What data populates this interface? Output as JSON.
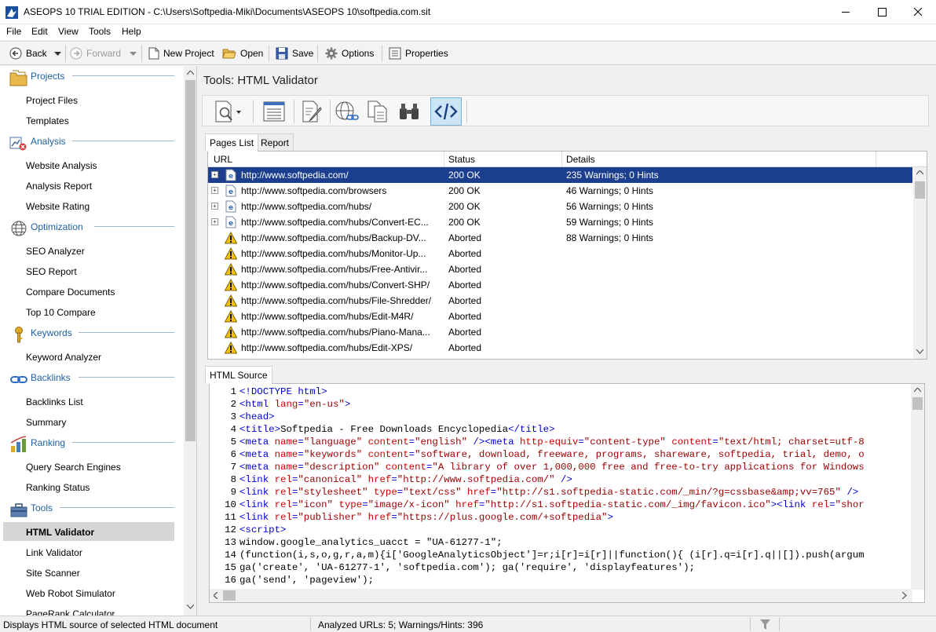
{
  "window": {
    "title": "ASEOPS 10 TRIAL EDITION - C:\\Users\\Softpedia-Miki\\Documents\\ASEOPS 10\\softpedia.com.sit",
    "minimize_icon": "minimize-icon",
    "maximize_icon": "maximize-icon",
    "close_icon": "close-icon"
  },
  "menu": [
    "File",
    "Edit",
    "View",
    "Tools",
    "Help"
  ],
  "toolbar": {
    "back": "Back",
    "forward": "Forward",
    "new_project": "New Project",
    "open": "Open",
    "save": "Save",
    "options": "Options",
    "properties": "Properties"
  },
  "sidebar": {
    "categories": [
      {
        "label": "Projects",
        "icon": "folders-icon",
        "items": [
          "Project Files",
          "Templates"
        ]
      },
      {
        "label": "Analysis",
        "icon": "analysis-icon",
        "items": [
          "Website Analysis",
          "Analysis Report",
          "Website Rating"
        ]
      },
      {
        "label": "Optimization",
        "icon": "globe-icon",
        "items": [
          "SEO Analyzer",
          "SEO Report",
          "Compare Documents",
          "Top 10 Compare"
        ]
      },
      {
        "label": "Keywords",
        "icon": "key-icon",
        "items": [
          "Keyword Analyzer"
        ]
      },
      {
        "label": "Backlinks",
        "icon": "chain-link-icon",
        "items": [
          "Backlinks List",
          "Summary"
        ]
      },
      {
        "label": "Ranking",
        "icon": "ranking-chart-icon",
        "items": [
          "Query Search Engines",
          "Ranking Status"
        ]
      },
      {
        "label": "Tools",
        "icon": "toolbox-icon",
        "items": [
          "HTML Validator",
          "Link Validator",
          "Site Scanner",
          "Web Robot Simulator",
          "PageRank Calculator"
        ]
      }
    ],
    "selected": "HTML Validator"
  },
  "main": {
    "title": "Tools: HTML Validator",
    "tools": [
      "validate-page-icon",
      "list-icon",
      "edit-page-icon",
      "globe-link-icon",
      "copy-pages-icon",
      "binoculars-icon",
      "code-view-icon"
    ]
  },
  "pages_panel": {
    "tabs": [
      "Pages List",
      "Report"
    ],
    "active_tab": "Pages List",
    "columns": [
      "URL",
      "Status",
      "Details"
    ],
    "rows": [
      {
        "url": "http://www.softpedia.com/",
        "status": "200 OK",
        "details": "235 Warnings; 0 Hints",
        "type": "page",
        "selected": true
      },
      {
        "url": "http://www.softpedia.com/browsers",
        "status": "200 OK",
        "details": "46 Warnings; 0 Hints",
        "type": "page"
      },
      {
        "url": "http://www.softpedia.com/hubs/",
        "status": "200 OK",
        "details": "56 Warnings; 0 Hints",
        "type": "page"
      },
      {
        "url": "http://www.softpedia.com/hubs/Convert-EC...",
        "status": "200 OK",
        "details": "59 Warnings; 0 Hints",
        "type": "page"
      },
      {
        "url": "http://www.softpedia.com/hubs/Backup-DV...",
        "status": "Aborted",
        "details": "88 Warnings; 0 Hints",
        "type": "warning"
      },
      {
        "url": "http://www.softpedia.com/hubs/Monitor-Up...",
        "status": "Aborted",
        "details": "",
        "type": "warning"
      },
      {
        "url": "http://www.softpedia.com/hubs/Free-Antivir...",
        "status": "Aborted",
        "details": "",
        "type": "warning"
      },
      {
        "url": "http://www.softpedia.com/hubs/Convert-SHP/",
        "status": "Aborted",
        "details": "",
        "type": "warning"
      },
      {
        "url": "http://www.softpedia.com/hubs/File-Shredder/",
        "status": "Aborted",
        "details": "",
        "type": "warning"
      },
      {
        "url": "http://www.softpedia.com/hubs/Edit-M4R/",
        "status": "Aborted",
        "details": "",
        "type": "warning"
      },
      {
        "url": "http://www.softpedia.com/hubs/Piano-Mana...",
        "status": "Aborted",
        "details": "",
        "type": "warning"
      },
      {
        "url": "http://www.softpedia.com/hubs/Edit-XPS/",
        "status": "Aborted",
        "details": "",
        "type": "warning"
      }
    ]
  },
  "source_panel": {
    "tab": "HTML Source",
    "lines": [
      [
        [
          "t",
          "<!DOCTYPE html>"
        ]
      ],
      [
        [
          "t",
          "<html "
        ],
        [
          "a",
          "lang"
        ],
        [
          "t",
          "="
        ],
        [
          "v",
          "\"en-us\""
        ],
        [
          "t",
          ">"
        ]
      ],
      [
        [
          "t",
          "<head>"
        ]
      ],
      [
        [
          "t",
          "<title>"
        ],
        [
          "k",
          "Softpedia - Free Downloads Encyclopedia"
        ],
        [
          "t",
          "</title>"
        ]
      ],
      [
        [
          "t",
          "<meta "
        ],
        [
          "a",
          "name"
        ],
        [
          "t",
          "="
        ],
        [
          "v",
          "\"language\" "
        ],
        [
          "a",
          "content"
        ],
        [
          "t",
          "="
        ],
        [
          "v",
          "\"english\" "
        ],
        [
          "t",
          "/><meta "
        ],
        [
          "a",
          "http-equiv"
        ],
        [
          "t",
          "="
        ],
        [
          "v",
          "\"content-type\" "
        ],
        [
          "a",
          "content"
        ],
        [
          "t",
          "="
        ],
        [
          "v",
          "\"text/html; charset=utf-8"
        ]
      ],
      [
        [
          "t",
          "<meta "
        ],
        [
          "a",
          "name"
        ],
        [
          "t",
          "="
        ],
        [
          "v",
          "\"keywords\" "
        ],
        [
          "a",
          "content"
        ],
        [
          "t",
          "="
        ],
        [
          "v",
          "\"software, download, freeware, programs, shareware, softpedia, trial, demo, o"
        ]
      ],
      [
        [
          "t",
          "<meta "
        ],
        [
          "a",
          "name"
        ],
        [
          "t",
          "="
        ],
        [
          "v",
          "\"description\" "
        ],
        [
          "a",
          "content"
        ],
        [
          "t",
          "="
        ],
        [
          "v",
          "\"A library of over 1,000,000 free and free-to-try applications for Windows"
        ]
      ],
      [
        [
          "t",
          "<link "
        ],
        [
          "a",
          "rel"
        ],
        [
          "t",
          "="
        ],
        [
          "v",
          "\"canonical\" "
        ],
        [
          "a",
          "href"
        ],
        [
          "t",
          "="
        ],
        [
          "v",
          "\"http://www.softpedia.com/\" "
        ],
        [
          "t",
          "/>"
        ]
      ],
      [
        [
          "t",
          "<link "
        ],
        [
          "a",
          "rel"
        ],
        [
          "t",
          "="
        ],
        [
          "v",
          "\"stylesheet\" "
        ],
        [
          "a",
          "type"
        ],
        [
          "t",
          "="
        ],
        [
          "v",
          "\"text/css\" "
        ],
        [
          "a",
          "href"
        ],
        [
          "t",
          "="
        ],
        [
          "v",
          "\"http://s1.softpedia-static.com/_min/?g=cssbase&amp;vv=765\" "
        ],
        [
          "t",
          "/>"
        ]
      ],
      [
        [
          "t",
          "<link "
        ],
        [
          "a",
          "rel"
        ],
        [
          "t",
          "="
        ],
        [
          "v",
          "\"icon\" "
        ],
        [
          "a",
          "type"
        ],
        [
          "t",
          "="
        ],
        [
          "v",
          "\"image/x-icon\" "
        ],
        [
          "a",
          "href"
        ],
        [
          "t",
          "="
        ],
        [
          "v",
          "\"http://s1.softpedia-static.com/_img/favicon.ico\""
        ],
        [
          "t",
          "><link "
        ],
        [
          "a",
          "rel"
        ],
        [
          "t",
          "="
        ],
        [
          "v",
          "\"shor"
        ]
      ],
      [
        [
          "t",
          "<link "
        ],
        [
          "a",
          "rel"
        ],
        [
          "t",
          "="
        ],
        [
          "v",
          "\"publisher\" "
        ],
        [
          "a",
          "href"
        ],
        [
          "t",
          "="
        ],
        [
          "v",
          "\"https://plus.google.com/+softpedia\""
        ],
        [
          "t",
          ">"
        ]
      ],
      [
        [
          "t",
          "<script>"
        ]
      ],
      [
        [
          "k",
          "window.google_analytics_uacct = \"UA-61277-1\";"
        ]
      ],
      [
        [
          "k",
          "(function(i,s,o,g,r,a,m){i['GoogleAnalyticsObject']=r;i[r]=i[r]||function(){ (i[r].q=i[r].q||[]).push(argum"
        ]
      ],
      [
        [
          "k",
          "ga('create', 'UA-61277-1', 'softpedia.com'); ga('require', 'displayfeatures');"
        ]
      ],
      [
        [
          "k",
          "ga('send', 'pageview');"
        ]
      ]
    ]
  },
  "status": {
    "hint": "Displays HTML source of selected HTML document",
    "summary": "Analyzed URLs: 5; Warnings/Hints: 396",
    "filter_icon": "filter-icon"
  }
}
